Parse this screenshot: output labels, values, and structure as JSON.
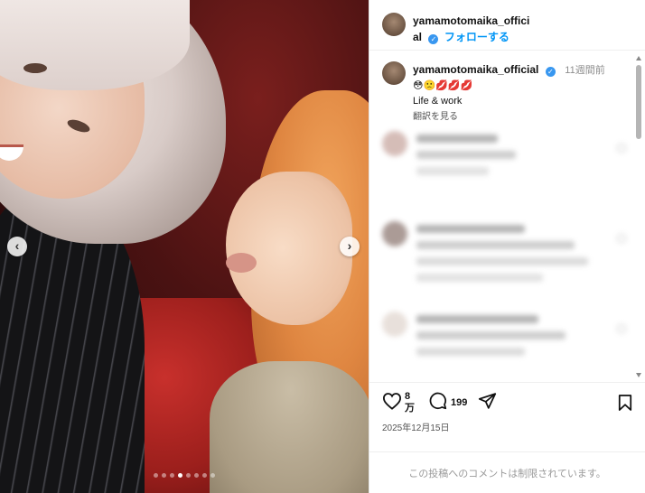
{
  "post": {
    "username": "yamamotomaika_official",
    "follow_label": "フォローする",
    "verified_mark": "✓",
    "caption": {
      "username": "yamamotomaika_official",
      "time": "11週間前",
      "emojis": "😳🙁💋💋💋",
      "text": "Life & work",
      "translate_label": "翻訳を見る"
    },
    "likes": {
      "count_top": "8",
      "count_bottom": "万"
    },
    "comments_count": "199",
    "date": "2025年12月15日",
    "comments_restricted": "この投稿へのコメントは制限されています。"
  },
  "carousel": {
    "prev_label": "‹",
    "next_label": "›",
    "slide_count": 8,
    "active_index": 3
  },
  "icons": [
    "heart-icon",
    "comment-icon",
    "share-icon",
    "bookmark-icon",
    "verified-badge-icon",
    "chevron-left-icon",
    "chevron-right-icon"
  ],
  "colors": {
    "link_blue": "#0095f6",
    "verified_blue": "#3897f0"
  }
}
